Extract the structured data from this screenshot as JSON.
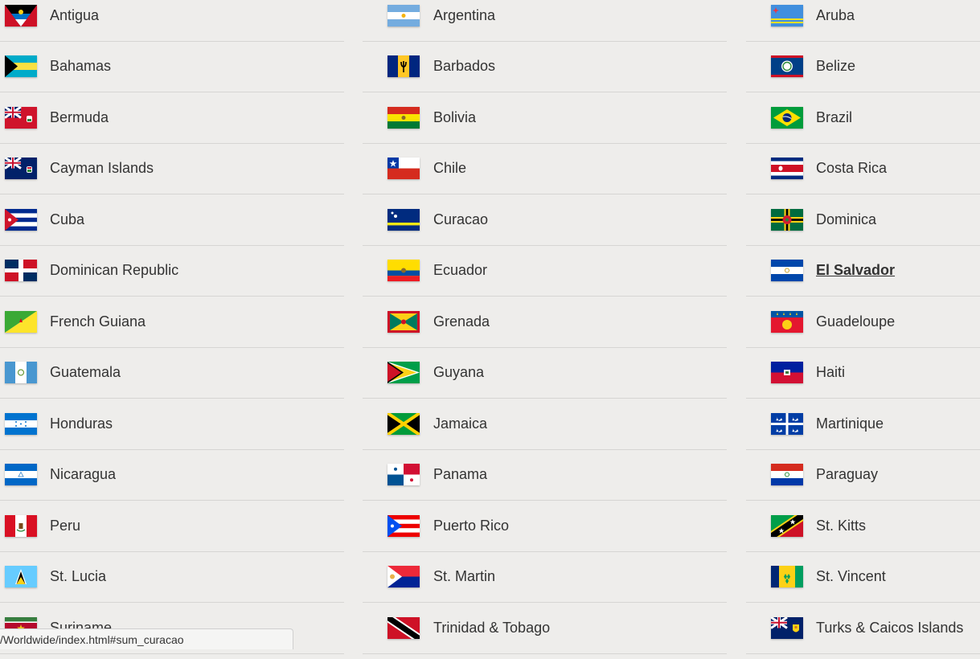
{
  "columns": [
    [
      {
        "name": "Antigua",
        "flag": "antigua-flag"
      },
      {
        "name": "Bahamas",
        "flag": "bahamas-flag"
      },
      {
        "name": "Bermuda",
        "flag": "bermuda-flag"
      },
      {
        "name": "Cayman Islands",
        "flag": "cayman-islands-flag"
      },
      {
        "name": "Cuba",
        "flag": "cuba-flag"
      },
      {
        "name": "Dominican Republic",
        "flag": "dominican-republic-flag"
      },
      {
        "name": "French Guiana",
        "flag": "french-guiana-flag"
      },
      {
        "name": "Guatemala",
        "flag": "guatemala-flag"
      },
      {
        "name": "Honduras",
        "flag": "honduras-flag"
      },
      {
        "name": "Nicaragua",
        "flag": "nicaragua-flag"
      },
      {
        "name": "Peru",
        "flag": "peru-flag"
      },
      {
        "name": "St. Lucia",
        "flag": "st-lucia-flag"
      },
      {
        "name": "Suriname",
        "flag": "suriname-flag"
      }
    ],
    [
      {
        "name": "Argentina",
        "flag": "argentina-flag"
      },
      {
        "name": "Barbados",
        "flag": "barbados-flag"
      },
      {
        "name": "Bolivia",
        "flag": "bolivia-flag"
      },
      {
        "name": "Chile",
        "flag": "chile-flag"
      },
      {
        "name": "Curacao",
        "flag": "curacao-flag"
      },
      {
        "name": "Ecuador",
        "flag": "ecuador-flag"
      },
      {
        "name": "Grenada",
        "flag": "grenada-flag"
      },
      {
        "name": "Guyana",
        "flag": "guyana-flag"
      },
      {
        "name": "Jamaica",
        "flag": "jamaica-flag"
      },
      {
        "name": "Panama",
        "flag": "panama-flag"
      },
      {
        "name": "Puerto Rico",
        "flag": "puerto-rico-flag"
      },
      {
        "name": "St. Martin",
        "flag": "st-martin-flag"
      },
      {
        "name": "Trinidad & Tobago",
        "flag": "trinidad-tobago-flag"
      }
    ],
    [
      {
        "name": "Aruba",
        "flag": "aruba-flag"
      },
      {
        "name": "Belize",
        "flag": "belize-flag"
      },
      {
        "name": "Brazil",
        "flag": "brazil-flag"
      },
      {
        "name": "Costa Rica",
        "flag": "costa-rica-flag"
      },
      {
        "name": "Dominica",
        "flag": "dominica-flag"
      },
      {
        "name": "El Salvador",
        "flag": "el-salvador-flag",
        "hover": true
      },
      {
        "name": "Guadeloupe",
        "flag": "guadeloupe-flag"
      },
      {
        "name": "Haiti",
        "flag": "haiti-flag"
      },
      {
        "name": "Martinique",
        "flag": "martinique-flag"
      },
      {
        "name": "Paraguay",
        "flag": "paraguay-flag"
      },
      {
        "name": "St. Kitts",
        "flag": "st-kitts-flag"
      },
      {
        "name": "St. Vincent",
        "flag": "st-vincent-flag"
      },
      {
        "name": "Turks & Caicos Islands",
        "flag": "turks-caicos-islands-flag"
      }
    ]
  ],
  "status_bar": {
    "url": "/Worldwide/index.html#sum_curacao"
  }
}
